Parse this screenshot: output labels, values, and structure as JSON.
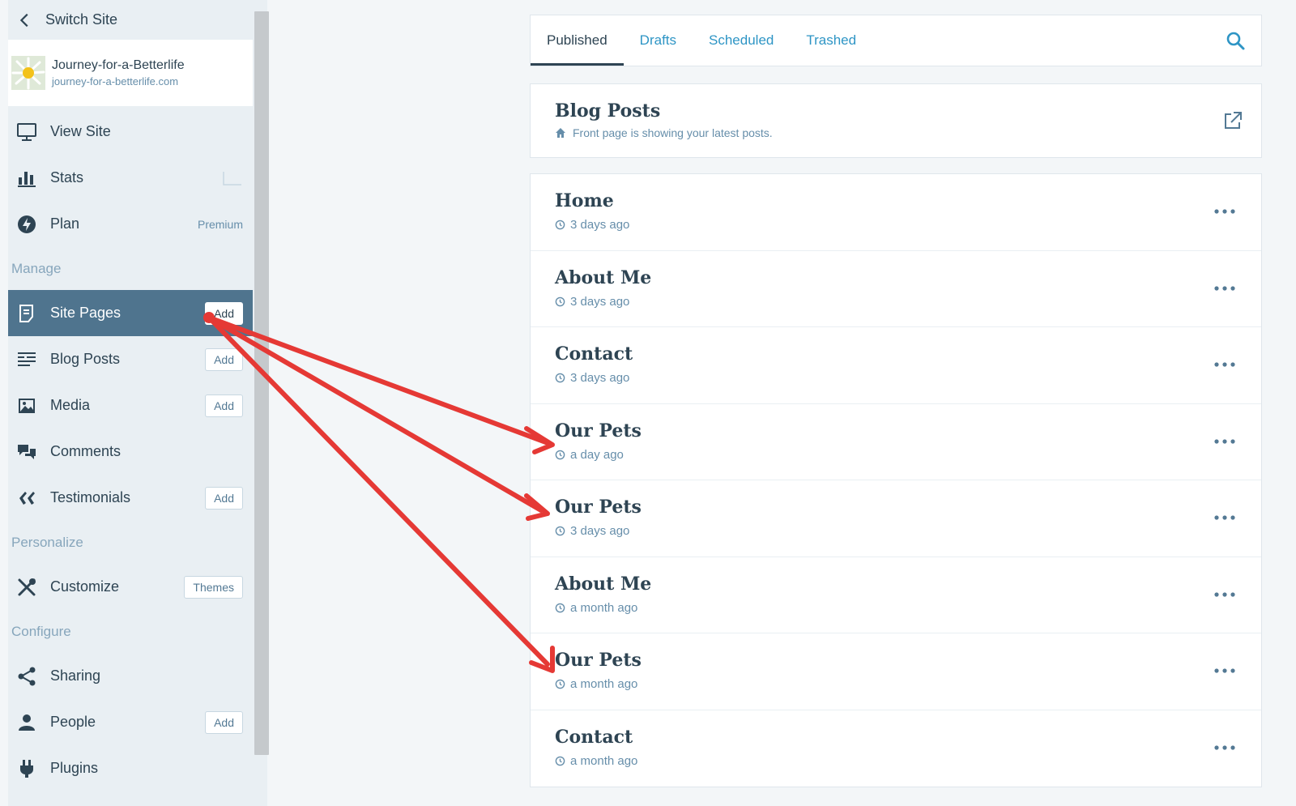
{
  "sidebar": {
    "switch_site": "Switch Site",
    "site": {
      "name": "Journey-for-a-Betterlife",
      "url": "journey-for-a-betterlife.com"
    },
    "top_items": [
      {
        "label": "View Site",
        "icon": "monitor-icon"
      },
      {
        "label": "Stats",
        "icon": "bar-chart-icon"
      },
      {
        "label": "Plan",
        "icon": "plan-icon",
        "right": "Premium"
      }
    ],
    "sections": {
      "manage": "Manage",
      "personalize": "Personalize",
      "configure": "Configure"
    },
    "manage_items": [
      {
        "label": "Site Pages",
        "icon": "page-icon",
        "button": "Add",
        "active": true
      },
      {
        "label": "Blog Posts",
        "icon": "posts-icon",
        "button": "Add"
      },
      {
        "label": "Media",
        "icon": "image-icon",
        "button": "Add"
      },
      {
        "label": "Comments",
        "icon": "comments-icon"
      },
      {
        "label": "Testimonials",
        "icon": "quote-icon",
        "button": "Add"
      }
    ],
    "personalize_items": [
      {
        "label": "Customize",
        "icon": "tools-icon",
        "button": "Themes"
      }
    ],
    "configure_items": [
      {
        "label": "Sharing",
        "icon": "share-icon"
      },
      {
        "label": "People",
        "icon": "person-icon",
        "button": "Add"
      },
      {
        "label": "Plugins",
        "icon": "plug-icon"
      }
    ]
  },
  "tabs": [
    "Published",
    "Drafts",
    "Scheduled",
    "Trashed"
  ],
  "blog_posts_card": {
    "title": "Blog Posts",
    "subtitle": "Front page is showing your latest posts."
  },
  "pages": [
    {
      "title": "Home",
      "time": "3 days ago"
    },
    {
      "title": "About Me",
      "time": "3 days ago"
    },
    {
      "title": "Contact",
      "time": "3 days ago"
    },
    {
      "title": "Our Pets",
      "time": "a day ago"
    },
    {
      "title": "Our Pets",
      "time": "3 days ago"
    },
    {
      "title": "About Me",
      "time": "a month ago"
    },
    {
      "title": "Our Pets",
      "time": "a month ago"
    },
    {
      "title": "Contact",
      "time": "a month ago"
    }
  ],
  "colors": {
    "accent": "#2e95c5",
    "active_nav": "#4f748e",
    "annotation_arrow": "#e53935"
  }
}
